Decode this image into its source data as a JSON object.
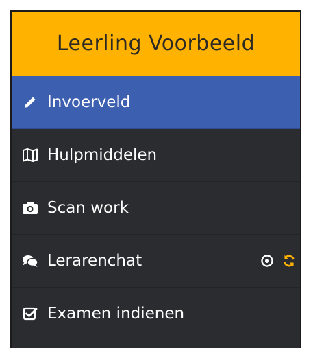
{
  "header": {
    "title": "Leerling Voorbeeld"
  },
  "colors": {
    "header_bg": "#ffb300",
    "active_bg": "#3d5fb0",
    "sidebar_bg": "#2b2c2f",
    "sync_icon": "#ffb300"
  },
  "menu": {
    "items": [
      {
        "label": "Invoerveld",
        "icon": "pencil-icon",
        "active": true
      },
      {
        "label": "Hulpmiddelen",
        "icon": "map-icon",
        "active": false
      },
      {
        "label": "Scan work",
        "icon": "camera-icon",
        "active": false
      },
      {
        "label": "Lerarenchat",
        "icon": "chat-bubbles-icon",
        "active": false,
        "trailing_icons": [
          "dot-circle-icon",
          "sync-icon"
        ]
      },
      {
        "label": "Examen indienen",
        "icon": "checkbox-icon",
        "active": false
      }
    ]
  }
}
